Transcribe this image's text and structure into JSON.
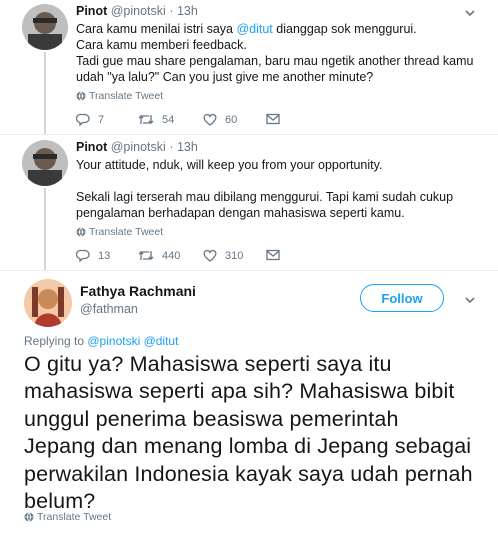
{
  "tweets": [
    {
      "name": "Pinot",
      "handle": "@pinotski",
      "sep": "·",
      "time": "13h",
      "lines": [
        {
          "pre": "Cara kamu menilai istri saya ",
          "mention": "@ditut",
          "post": " dianggap sok menggurui."
        },
        {
          "pre": "Cara kamu memberi feedback.",
          "mention": "",
          "post": ""
        },
        {
          "pre": "Tadi gue mau share pengalaman, baru mau ngetik another thread kamu",
          "mention": "",
          "post": ""
        },
        {
          "pre": "udah \"ya lalu?\" Can you just give me another minute?",
          "mention": "",
          "post": ""
        }
      ],
      "translate": "Translate Tweet",
      "replies": "7",
      "retweets": "54",
      "likes": "60"
    },
    {
      "name": "Pinot",
      "handle": "@pinotski",
      "sep": "·",
      "time": "13h",
      "lines": [
        {
          "pre": "Your attitude, nduk, will keep you from your opportunity.",
          "mention": "",
          "post": ""
        },
        {
          "pre": "",
          "mention": "",
          "post": ""
        },
        {
          "pre": "Sekali lagi terserah mau dibilang menggurui. Tapi kami sudah cukup",
          "mention": "",
          "post": ""
        },
        {
          "pre": "pengalaman berhadapan dengan mahasiswa seperti kamu.",
          "mention": "",
          "post": ""
        }
      ],
      "translate": "Translate Tweet",
      "replies": "13",
      "retweets": "440",
      "likes": "310"
    }
  ],
  "main_tweet": {
    "name": "Fathya Rachmani",
    "handle": "@fathman",
    "follow_label": "Follow",
    "replying_prefix": "Replying to ",
    "replying_to": "@pinotski @ditut",
    "lines": [
      "O gitu ya? Mahasiswa seperti saya itu",
      "mahasiswa seperti apa sih? Mahasiswa bibit",
      "unggul penerima beasiswa pemerintah",
      "Jepang dan menang lomba di Jepang sebagai",
      "perwakilan Indonesia kayak saya udah pernah",
      "belum?"
    ],
    "translate": "Translate Tweet"
  },
  "colors": {
    "accent": "#1da1f2",
    "text": "#14171a",
    "secondary": "#657786",
    "divider": "#e6ecf0"
  },
  "icons": [
    "chevron-down-icon",
    "globe-icon",
    "reply-icon",
    "retweet-icon",
    "like-icon",
    "message-icon"
  ]
}
